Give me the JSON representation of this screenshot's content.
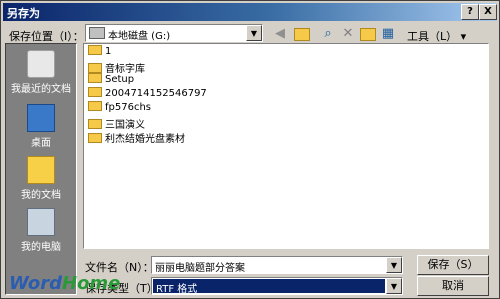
{
  "window": {
    "title": "另存为"
  },
  "titlebar": {
    "help_label": "?",
    "close_label": "X"
  },
  "save_location": {
    "label": "保存位置（I）：",
    "value": "本地磁盘 (G:)"
  },
  "toolbar": {
    "tools_label": "工具（L）"
  },
  "places": [
    {
      "label": "我最近的文档",
      "icon": "recent-documents-icon"
    },
    {
      "label": "桌面",
      "icon": "desktop-icon"
    },
    {
      "label": "我的文档",
      "icon": "my-documents-icon"
    },
    {
      "label": "我的电脑",
      "icon": "my-computer-icon"
    }
  ],
  "files": [
    "1",
    "音标字库",
    "Setup",
    "2004714152546797",
    "fp576chs",
    "三国演义",
    "利杰结婚光盘素材"
  ],
  "filename": {
    "label": "文件名（N）：",
    "value": "丽丽电脑题部分答案"
  },
  "filetype": {
    "label": "保存类型（T）：",
    "value": "RTF 格式"
  },
  "buttons": {
    "save": "保存（S）",
    "cancel": "取消"
  },
  "watermark": {
    "text_a": "Word",
    "text_b": "Home"
  },
  "colors": {
    "titlebar": "#0a246a",
    "selection": "#0a246a",
    "folder": "#f7c948"
  }
}
